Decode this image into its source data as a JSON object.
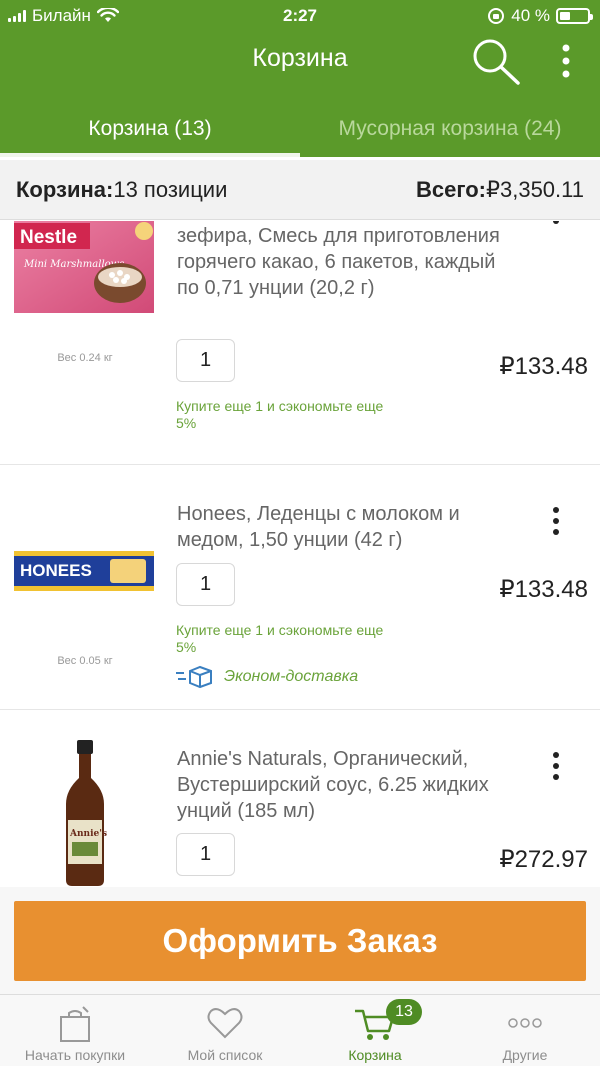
{
  "status_bar": {
    "carrier": "Билайн",
    "time": "2:27",
    "battery": "40 %",
    "battery_level": 0.4
  },
  "header": {
    "title": "Корзина",
    "search_icon": "search-icon",
    "more_icon": "more-vertical-icon"
  },
  "tabs": [
    {
      "label": "Корзина (13)",
      "active": true
    },
    {
      "label": "Мусорная корзина (24)",
      "active": false
    }
  ],
  "summary": {
    "count_label": "Корзина:",
    "count_value": "13 позиции",
    "total_label": "Всего:",
    "total_value": "₽3,350.11"
  },
  "items": [
    {
      "name": "зефира, Смесь для приготовления горячего какао, 6 пакетов, каждый по 0,71 унции (20,2 г)",
      "weight": "Вес 0.24 кг",
      "quantity": "1",
      "price": "₽133.48",
      "promo": "Купите еще 1 и сэкономьте еще 5%",
      "image_label": "Nestle",
      "image_sub": "Mini Marshmallows"
    },
    {
      "name": "Honees, Леденцы с молоком и медом, 1,50 унции (42 г)",
      "weight": "Вес 0.05 кг",
      "quantity": "1",
      "price": "₽133.48",
      "promo": "Купите еще 1 и сэкономьте еще 5%",
      "shipping": "Эконом-доставка",
      "image_label": "HONEES"
    },
    {
      "name": "Annie's Naturals, Органический, Вустерширский соус, 6.25 жидких унций (185 мл)",
      "quantity": "1",
      "price": "₽272.97",
      "image_label": "Annie's"
    }
  ],
  "checkout": {
    "label": "Оформить Заказ"
  },
  "nav": [
    {
      "label": "Начать покупки",
      "icon": "shopping-bag-icon"
    },
    {
      "label": "Мой список",
      "icon": "heart-icon"
    },
    {
      "label": "Корзина",
      "icon": "cart-icon",
      "badge": "13",
      "active": true
    },
    {
      "label": "Другие",
      "icon": "more-horizontal-icon"
    }
  ],
  "colors": {
    "brand_green": "#5b9a2a",
    "accent_orange": "#e89030",
    "promo_green": "#6aa33a"
  }
}
